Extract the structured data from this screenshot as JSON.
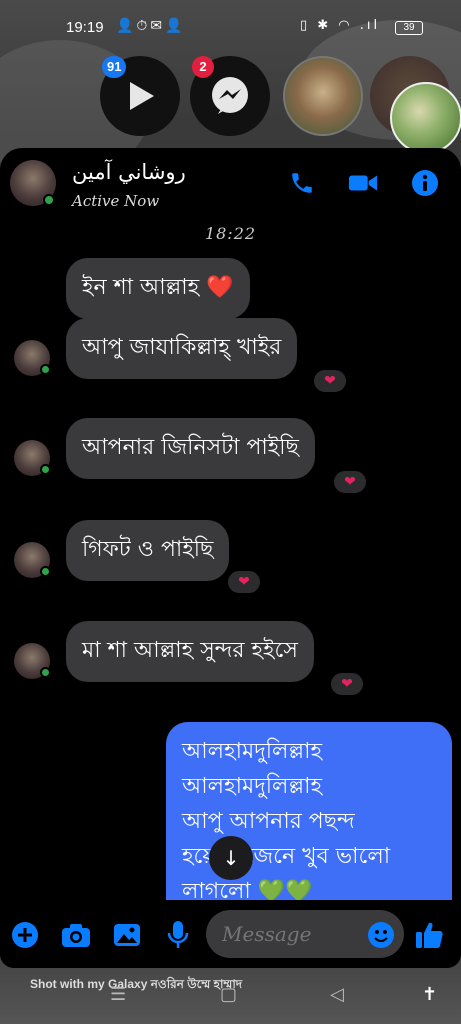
{
  "status_bar": {
    "time": "19:19",
    "left_icons": "👤⏱✉👤",
    "right_icons": "▯ ✱ ◠ .ıl",
    "battery": "39"
  },
  "chat_heads": {
    "play_badge": "91",
    "messenger_badge": "2"
  },
  "header": {
    "contact_name": "روشاني آمين",
    "status": "Active Now"
  },
  "timestamp": "18:22",
  "messages": {
    "m1": "ইন শা আল্লাহ ❤️",
    "m2": "আপু জাযাকিল্লাহ্ খাইর",
    "m3": "আপনার জিনিসটা পাইছি",
    "m4": "গিফট ও পাইছি",
    "m5": "মা শা আল্লাহ সুন্দর হইসে",
    "out_line1": "আলহামদুলিল্লাহ",
    "out_line2": "আলহামদুলিল্লাহ",
    "out_line3": "আপু আপনার পছন্দ",
    "out_line4": "হয়েছে জেনে খুব ভালো",
    "out_line5": "লাগলো 💚💚"
  },
  "reaction": "❤",
  "composer": {
    "placeholder": "Message"
  },
  "watermark": "Shot with my Galaxy নওরিন উম্মে হাম্মাদ",
  "colors": {
    "messenger_blue": "#0a7cff",
    "outgoing_bubble": "#3f6ff6",
    "incoming_bubble": "#3a3a3c",
    "online": "#31a24c",
    "badge_blue": "#1877f2",
    "badge_red": "#e41e3f"
  }
}
